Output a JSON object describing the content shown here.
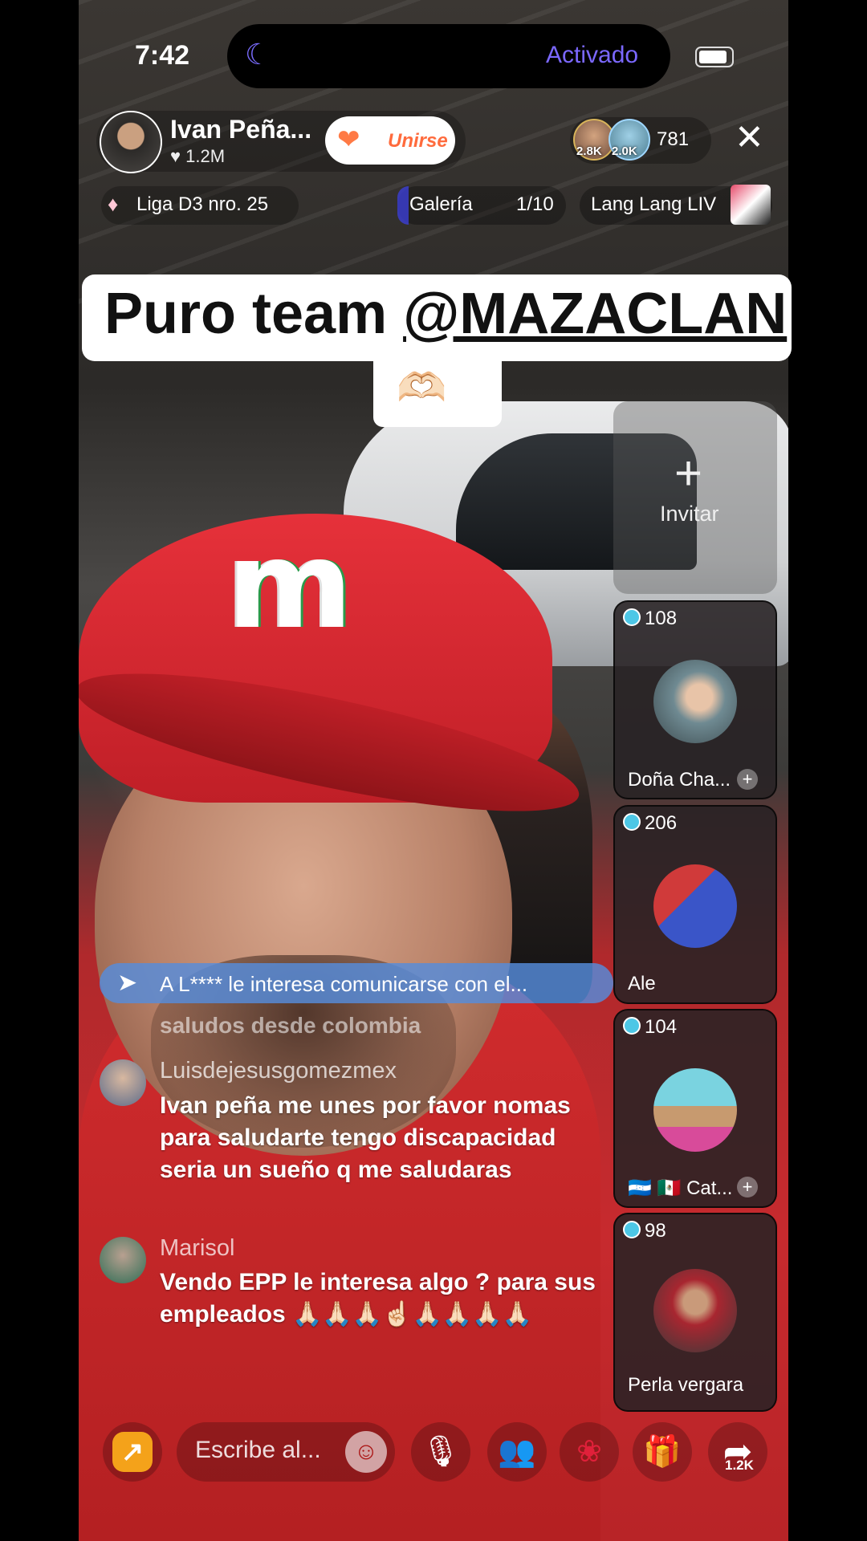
{
  "status": {
    "time": "7:42",
    "focus_label": "Activado",
    "focus_icon": "moon-icon"
  },
  "header": {
    "host_name": "Ivan Peña...",
    "host_likes": "♥ 1.2M",
    "join_label": "Unirse",
    "viewer_badges": [
      "2.8K",
      "2.0K"
    ],
    "viewer_count": "781",
    "close_icon": "close-icon"
  },
  "subheader": {
    "league": "Liga D3 nro. 25",
    "gallery_label": "Galería",
    "gallery_count": "1/10",
    "promo_label": "Lang Lang LIV"
  },
  "banner": {
    "prefix": "Puro team ",
    "tag": "@MAZACLAN",
    "emoji": "🫶🏻"
  },
  "invite": {
    "label": "Invitar"
  },
  "guests": [
    {
      "score": "108",
      "name": "Doña Cha...",
      "has_plus": true
    },
    {
      "score": "206",
      "name": "Ale",
      "has_plus": false
    },
    {
      "score": "104",
      "name": "🇭🇳 🇲🇽  Cat...",
      "has_plus": true
    },
    {
      "score": "98",
      "name": "Perla vergara",
      "has_plus": false
    }
  ],
  "notice": {
    "text": "A L**** le interesa comunicarse con el..."
  },
  "chat": {
    "faded": "saludos desde colombia",
    "messages": [
      {
        "user": "Luisdejesusgomezmex",
        "text": "Ivan peña me unes por favor nomas para saludarte tengo discapacidad seria un sueño q me saludaras"
      },
      {
        "user": "Marisol",
        "text": "Vendo EPP  le interesa algo ? para sus empleados 🙏🏻🙏🏻🙏🏻☝🏻🙏🏻🙏🏻🙏🏻🙏🏻"
      }
    ]
  },
  "toolbar": {
    "input_placeholder": "Escribe al...",
    "share_count": "1.2K"
  },
  "colors": {
    "accent": "#7b68ff",
    "join": "#ff6b3d",
    "notice": "#568cdc",
    "badge": "#4dc7e6"
  }
}
